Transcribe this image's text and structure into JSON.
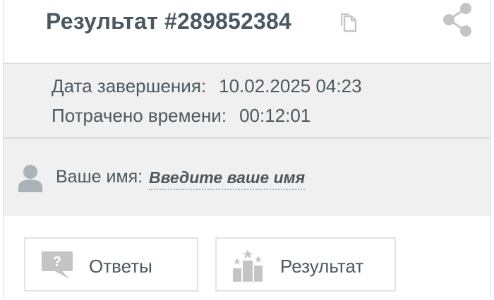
{
  "header": {
    "title": "Результат #289852384",
    "copy_icon": "copy-icon",
    "share_icon": "share-icon"
  },
  "info": {
    "completion_label": "Дата завершения:",
    "completion_value": "10.02.2025 04:23",
    "time_label": "Потрачено времени:",
    "time_value": "00:12:01"
  },
  "name": {
    "icon": "user-icon",
    "label": "Ваше имя:",
    "placeholder": "Введите ваше имя"
  },
  "buttons": {
    "answers": {
      "label": "Ответы",
      "icon": "question-bubble-icon"
    },
    "result": {
      "label": "Результат",
      "icon": "podium-stars-icon"
    }
  },
  "colors": {
    "text": "#4b5860",
    "icon": "#bcbcbc",
    "section_bg": "#f0f0f0",
    "divider": "#dcdcdc"
  }
}
